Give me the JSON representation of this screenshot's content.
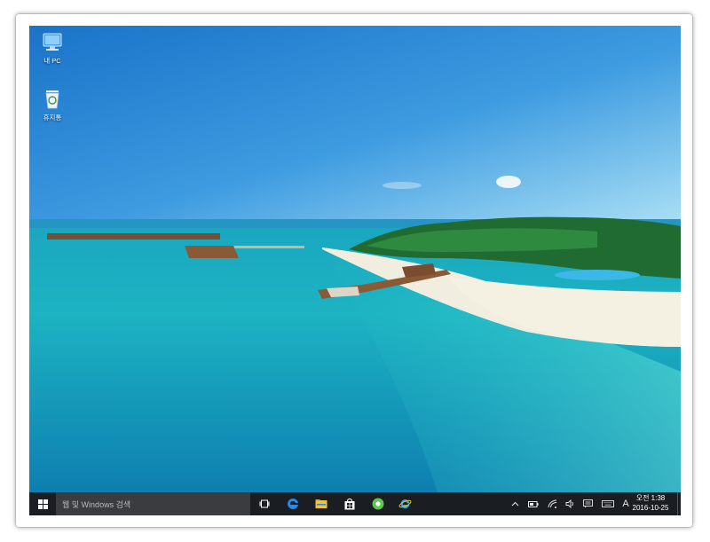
{
  "desktop": {
    "icons": [
      {
        "label": "내 PC",
        "icon": "this-pc-icon"
      },
      {
        "label": "휴지통",
        "icon": "recycle-bin-icon"
      }
    ]
  },
  "taskbar": {
    "start_icon": "windows-logo-icon",
    "search_placeholder": "웹 및 Windows 검색",
    "apps": [
      "task-view-icon",
      "edge-icon",
      "file-explorer-icon",
      "store-icon",
      "green-app-icon",
      "internet-explorer-icon"
    ],
    "tray": {
      "icons": [
        "chevron-up-icon",
        "battery-icon",
        "wifi-icon",
        "volume-icon",
        "action-center-icon",
        "keyboard-icon"
      ],
      "input_indicator": "A",
      "time": "오전 1:38",
      "date": "2016-10-25"
    }
  }
}
